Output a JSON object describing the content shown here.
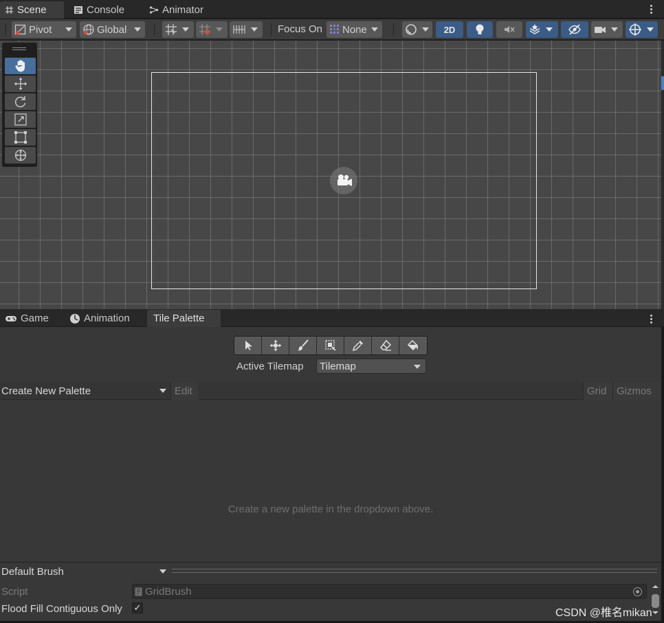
{
  "scene_tabs": {
    "scene": "Scene",
    "console": "Console",
    "animator": "Animator"
  },
  "toolbar": {
    "pivot": "Pivot",
    "global": "Global",
    "focus_on": "Focus On",
    "focus_value": "None",
    "two_d": "2D"
  },
  "bottom_tabs": {
    "game": "Game",
    "animation": "Animation",
    "tile_palette": "Tile Palette"
  },
  "tile_palette": {
    "active_tilemap_label": "Active Tilemap",
    "active_tilemap_value": "Tilemap",
    "palette_dropdown": "Create New Palette",
    "edit": "Edit",
    "grid": "Grid",
    "gizmos": "Gizmos",
    "empty_message": "Create a new palette in the dropdown above.",
    "brush_dropdown": "Default Brush",
    "script_label": "Script",
    "script_value": "GridBrush",
    "flood_fill_label": "Flood Fill Contiguous Only",
    "flood_fill_checked": "✓"
  },
  "watermark": "CSDN @椎名mikan",
  "colors": {
    "accent": "#3a5c86",
    "active_tool": "#486e9c",
    "scene_bg": "#474747",
    "panel_bg": "#383838"
  }
}
